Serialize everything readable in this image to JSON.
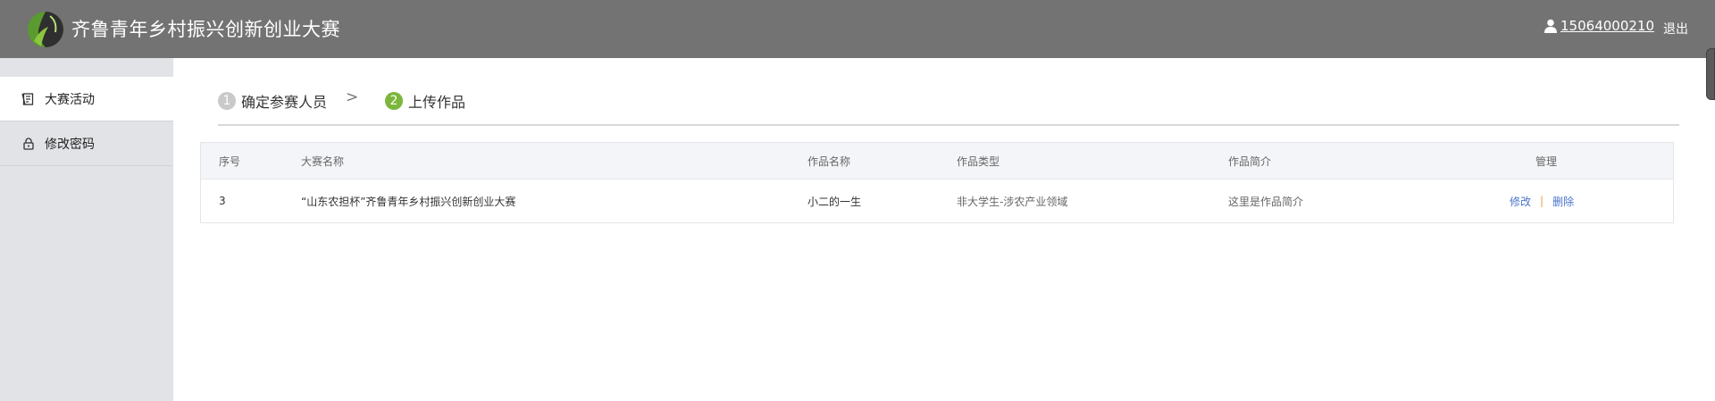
{
  "header": {
    "title": "齐鲁青年乡村振兴创新创业大赛",
    "user_phone": "15064000210",
    "logout_label": "退出",
    "bg_color": "#737373"
  },
  "sidebar": {
    "items": [
      {
        "label": "大赛活动",
        "icon": "contest-icon",
        "active": true
      },
      {
        "label": "修改密码",
        "icon": "lock-icon",
        "active": false
      }
    ]
  },
  "steps": {
    "step1": {
      "num": "1",
      "label": "确定参赛人员"
    },
    "separator": ">",
    "step2": {
      "num": "2",
      "label": "上传作品"
    }
  },
  "table": {
    "columns": [
      "序号",
      "大赛名称",
      "作品名称",
      "作品类型",
      "作品简介",
      "管理"
    ],
    "rows": [
      {
        "index": "3",
        "contest": "“山东农担杯”齐鲁青年乡村振兴创新创业大赛",
        "work_name": "小二的一生",
        "work_type": "非大学生-涉农产业领域",
        "intro": "这里是作品简介",
        "edit_label": "修改",
        "divider": "|",
        "delete_label": "删除"
      }
    ]
  },
  "colors": {
    "accent_green": "#7cb63a",
    "link_blue": "#4a74c9"
  }
}
